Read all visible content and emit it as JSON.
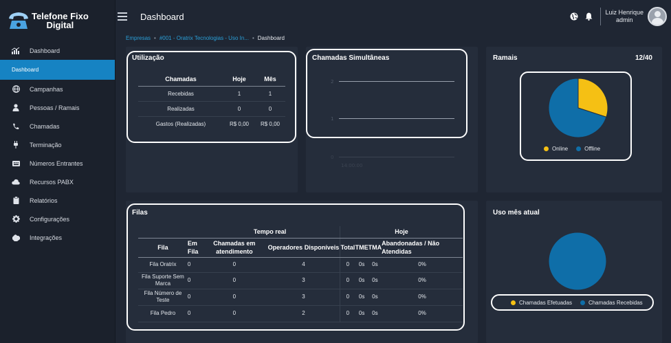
{
  "brand": {
    "line1": "Telefone Fixo",
    "line2": "Digital"
  },
  "sidebar": {
    "items": [
      {
        "label": "Dashboard",
        "icon": "chart-icon"
      },
      {
        "label": "Campanhas",
        "icon": "globe-icon"
      },
      {
        "label": "Pessoas / Ramais",
        "icon": "person-icon"
      },
      {
        "label": "Chamadas",
        "icon": "phone-icon"
      },
      {
        "label": "Terminação",
        "icon": "plug-icon"
      },
      {
        "label": "Números Entrantes",
        "icon": "keypad-icon"
      },
      {
        "label": "Recursos PABX",
        "icon": "cloud-icon"
      },
      {
        "label": "Relatórios",
        "icon": "clipboard-icon"
      },
      {
        "label": "Configurações",
        "icon": "gear-icon"
      },
      {
        "label": "Integrações",
        "icon": "puzzle-icon"
      }
    ],
    "active_sub": "Dashboard"
  },
  "topbar": {
    "title": "Dashboard",
    "user_name": "Luiz Henrique",
    "user_role": "admin"
  },
  "breadcrumb": {
    "empresas": "Empresas",
    "company": "#001 - Oratrix Tecnologias - Uso In...",
    "current": "Dashboard"
  },
  "utilizacao": {
    "title": "Utilização",
    "headers": [
      "Chamadas",
      "Hoje",
      "Mês"
    ],
    "rows": [
      [
        "Recebidas",
        "1",
        "1"
      ],
      [
        "Realizadas",
        "0",
        "0"
      ],
      [
        "Gastos (Realizadas)",
        "R$ 0,00",
        "R$ 0,00"
      ]
    ]
  },
  "simultaneas": {
    "title": "Chamadas Simultâneas",
    "ticks": [
      "2",
      "1",
      "0"
    ],
    "x_label": "14:00:00"
  },
  "ramais": {
    "title": "Ramais",
    "count": "12/40",
    "legend": [
      {
        "label": "Online",
        "color": "#f5c014"
      },
      {
        "label": "Offline",
        "color": "#0f6ea8"
      }
    ]
  },
  "filas": {
    "title": "Filas",
    "group_headers": {
      "tempo_real": "Tempo real",
      "hoje": "Hoje"
    },
    "headers": [
      "Fila",
      "Em Fila",
      "Chamadas em atendimento",
      "Operadores Disponíveis",
      "Total",
      "TME",
      "TMA",
      "Abandonadas / Não Atendidas"
    ],
    "rows": [
      [
        "Fila Oratrix",
        "0",
        "0",
        "4",
        "0",
        "0s",
        "0s",
        "0%"
      ],
      [
        "Fila Suporte Sem Marca",
        "0",
        "0",
        "3",
        "0",
        "0s",
        "0s",
        "0%"
      ],
      [
        "Fila Número de Teste",
        "0",
        "0",
        "3",
        "0",
        "0s",
        "0s",
        "0%"
      ],
      [
        "Fila Pedro",
        "0",
        "0",
        "2",
        "0",
        "0s",
        "0s",
        "0%"
      ]
    ]
  },
  "uso": {
    "title": "Uso mês atual",
    "legend": [
      {
        "label": "Chamadas Efetuadas",
        "color": "#f5c014"
      },
      {
        "label": "Chamadas Recebidas",
        "color": "#0f6ea8"
      }
    ]
  },
  "chart_data": [
    {
      "type": "pie",
      "title": "Ramais",
      "categories": [
        "Online",
        "Offline"
      ],
      "values": [
        12,
        28
      ],
      "colors": [
        "#f5c014",
        "#0f6ea8"
      ]
    },
    {
      "type": "pie",
      "title": "Uso mês atual",
      "categories": [
        "Chamadas Efetuadas",
        "Chamadas Recebidas"
      ],
      "values": [
        0,
        1
      ],
      "colors": [
        "#f5c014",
        "#0f6ea8"
      ]
    }
  ]
}
